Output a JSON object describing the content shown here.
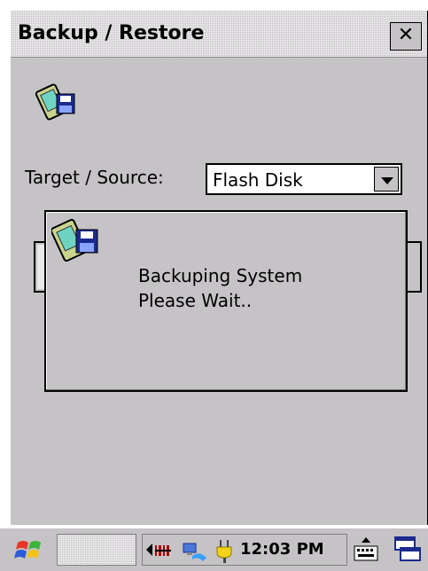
{
  "window": {
    "title": "Backup / Restore",
    "close_label": "✕"
  },
  "form": {
    "target_label": "Target / Source:",
    "target_value": "Flash Disk"
  },
  "dialog": {
    "line1": "Backuping System",
    "line2": "Please Wait.."
  },
  "taskbar": {
    "clock": "12:03 PM",
    "icons": [
      "start-icon",
      "barcode-icon",
      "network-icon",
      "power-icon",
      "keyboard-icon",
      "desktop-icon"
    ]
  },
  "colors": {
    "window_bg": "#c6c3c6",
    "accent_blue": "#1b2b8f",
    "pda_screen": "#6fd3c2"
  }
}
